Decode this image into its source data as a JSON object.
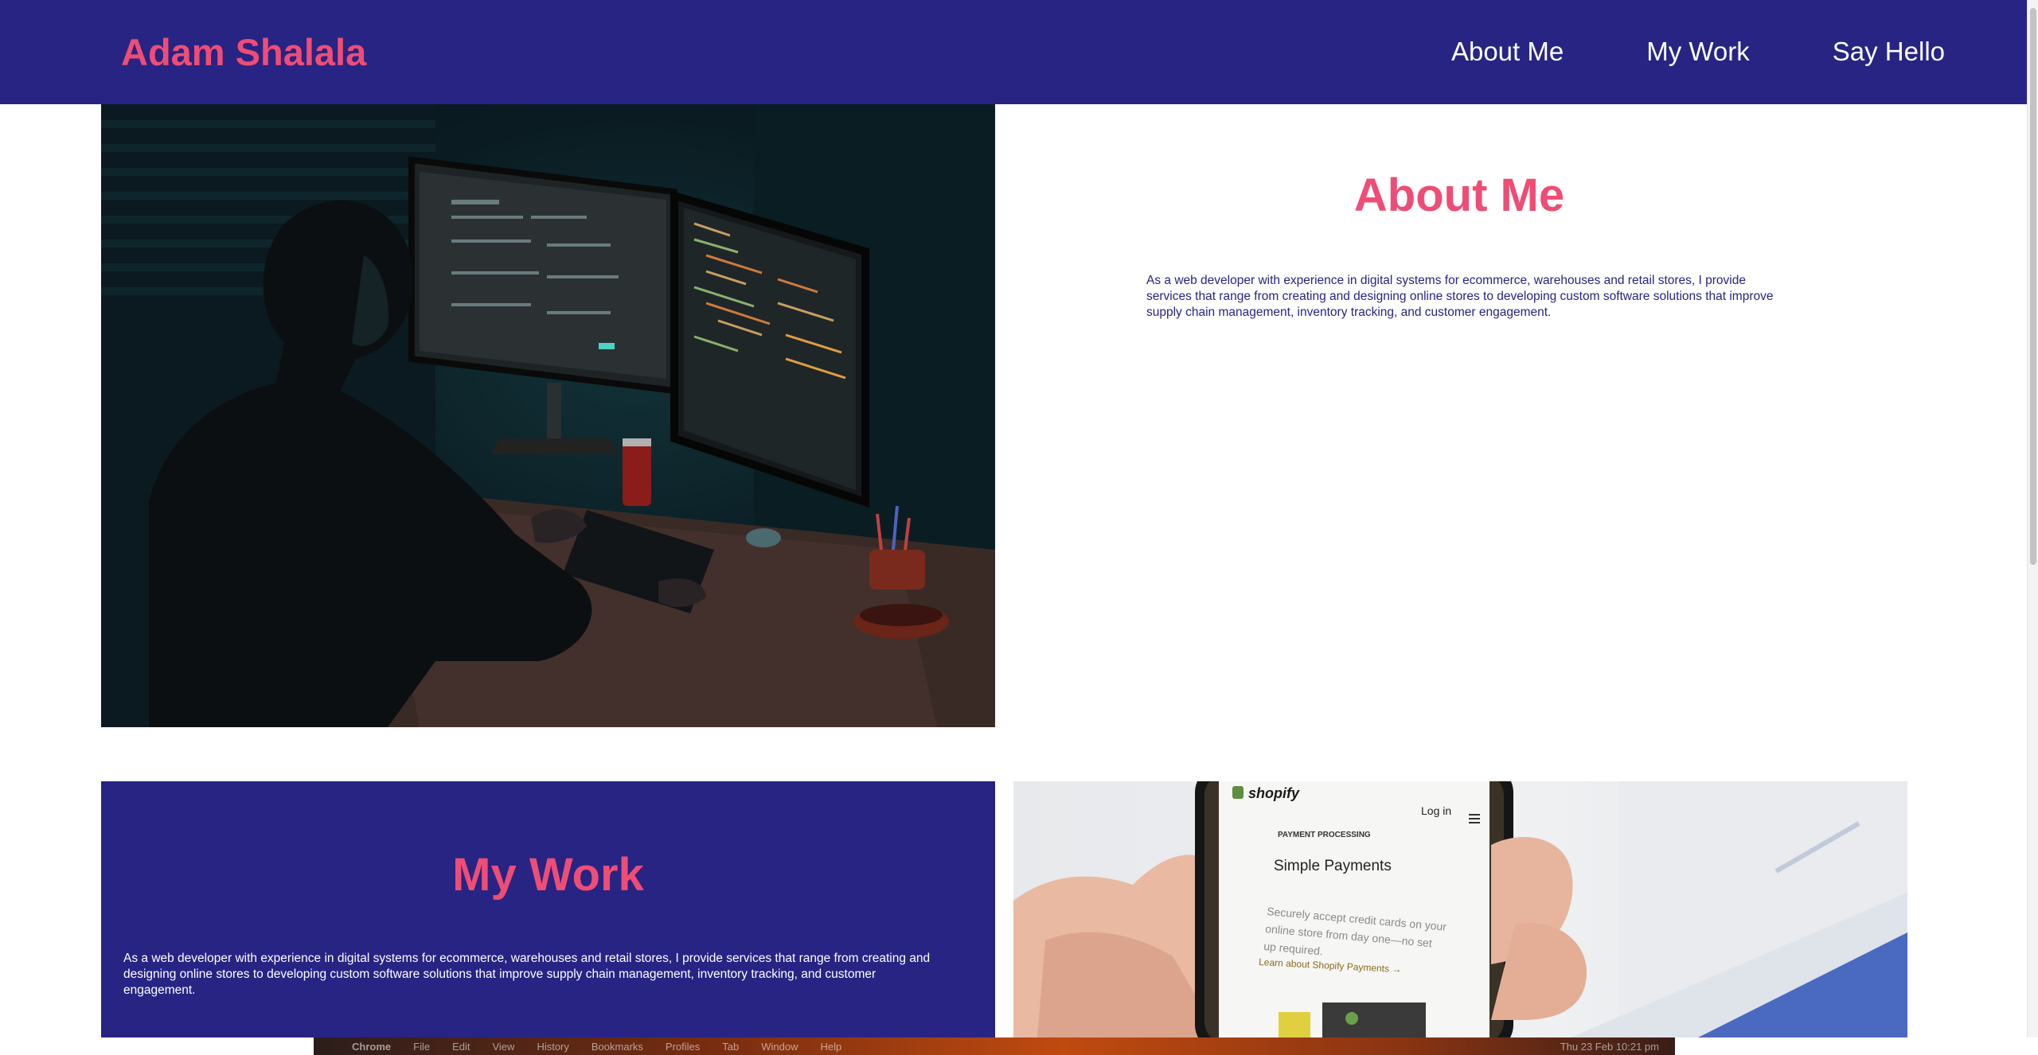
{
  "header": {
    "brand": "Adam Shalala",
    "nav": [
      "About Me",
      "My Work",
      "Say Hello"
    ]
  },
  "about": {
    "title": "About Me",
    "text": "As a web developer with experience in digital systems for ecommerce, warehouses and retail stores, I provide services that range from creating and designing online stores to developing custom software solutions that improve supply chain management, inventory tracking, and customer engagement."
  },
  "work": {
    "title": "My Work",
    "text": "As a web developer with experience in digital systems for ecommerce, warehouses and retail stores, I provide services that range from creating and designing online stores to developing custom software solutions that improve supply chain management, inventory tracking, and customer engagement."
  },
  "shopify_phone": {
    "logo": "shopify",
    "login": "Log in",
    "section": "PAYMENT PROCESSING",
    "heading": "Simple Payments",
    "body_lines": [
      "Securely accept credit cards on your",
      "online store from day one—no set",
      "up required."
    ],
    "link": "Learn about Shopify Payments →"
  },
  "menubar": {
    "apple": "",
    "app": "Chrome",
    "items": [
      "File",
      "Edit",
      "View",
      "History",
      "Bookmarks",
      "Profiles",
      "Tab",
      "Window",
      "Help"
    ],
    "clock": "Thu 23 Feb 10:21 pm"
  },
  "colors": {
    "navy": "#272484",
    "pink": "#ee4d75",
    "white": "#ffffff"
  }
}
